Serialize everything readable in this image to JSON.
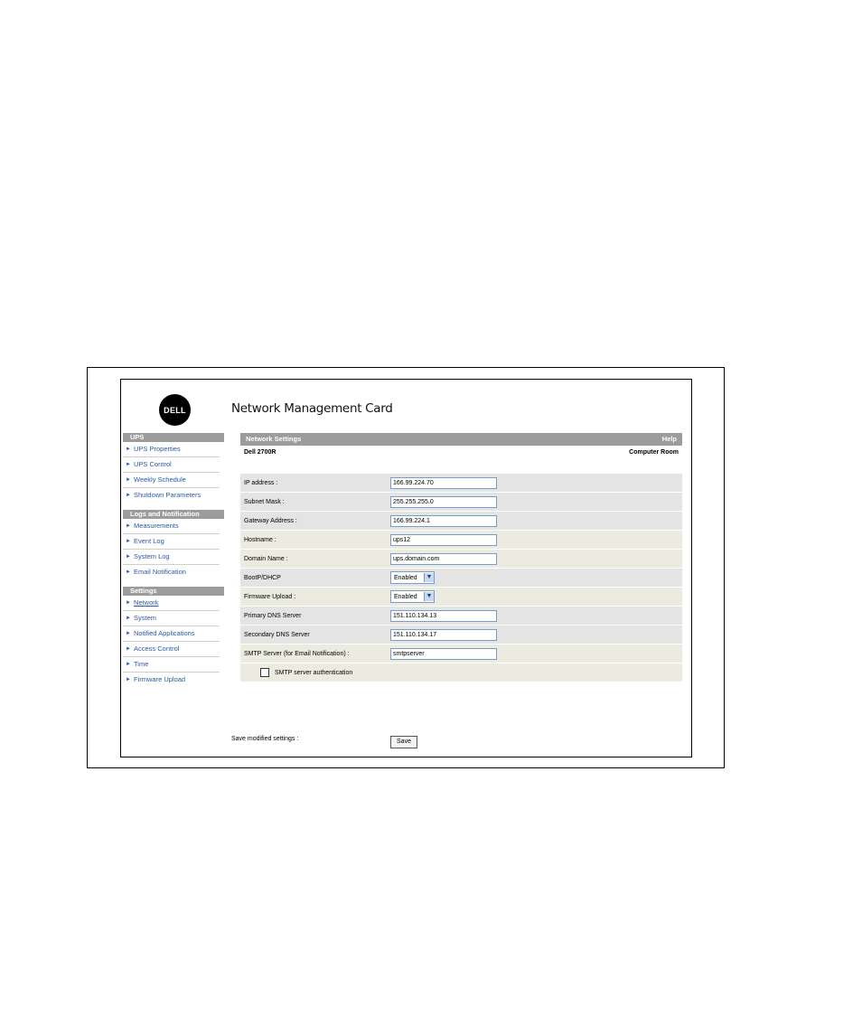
{
  "app": {
    "logo_text": "DELL",
    "title": "Network Management Card"
  },
  "sidebar": {
    "sections": [
      {
        "header": "UPS",
        "items": [
          "UPS Properties",
          "UPS Control",
          "Weekly Schedule",
          "Shutdown Parameters"
        ]
      },
      {
        "header": "Logs and Notification",
        "items": [
          "Measurements",
          "Event Log",
          "System Log",
          "Email Notification"
        ]
      },
      {
        "header": "Settings",
        "items": [
          "Network",
          "System",
          "Notified Applications",
          "Access Control",
          "Time",
          "Firmware Upload"
        ]
      }
    ]
  },
  "main": {
    "header_title": "Network Settings",
    "help_label": "Help",
    "device_name": "Dell 2700R",
    "location": "Computer Room",
    "fields": {
      "ip": {
        "label": "IP address :",
        "value": "166.99.224.70"
      },
      "subnet": {
        "label": "Subnet Mask :",
        "value": "255.255.255.0"
      },
      "gateway": {
        "label": "Gateway Address :",
        "value": "166.99.224.1"
      },
      "hostname": {
        "label": "Hostname :",
        "value": "ups12"
      },
      "domain": {
        "label": "Domain Name :",
        "value": "ups.domain.com"
      },
      "bootp": {
        "label": "BootP/DHCP",
        "value": "Enabled"
      },
      "firmware": {
        "label": "Firmware Upload :",
        "value": "Enabled"
      },
      "dns1": {
        "label": "Primary DNS Server",
        "value": "151.110.134.13"
      },
      "dns2": {
        "label": "Secondary DNS Server",
        "value": "151.110.134.17"
      },
      "smtp": {
        "label": "SMTP Server (for Email Notification) :",
        "value": "smtpserver"
      },
      "smtp_auth": {
        "label": "SMTP server authentication"
      }
    },
    "save_label": "Save modified settings :",
    "save_button": "Save"
  }
}
